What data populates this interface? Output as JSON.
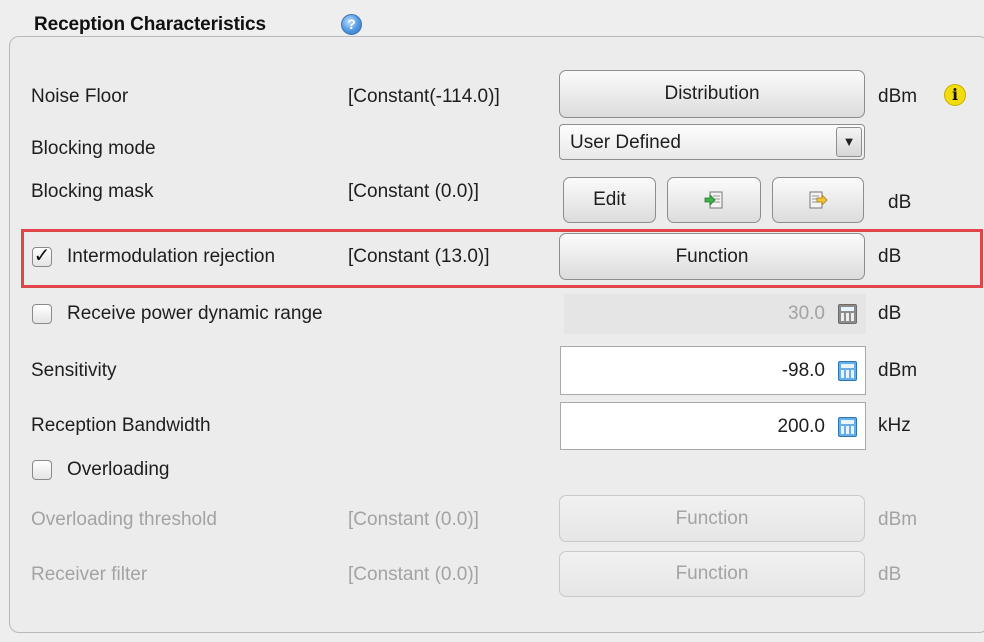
{
  "section": {
    "title": "Reception Characteristics"
  },
  "rows": {
    "noise_floor": {
      "label": "Noise Floor",
      "value": "[Constant(-114.0)]",
      "button": "Distribution",
      "unit": "dBm"
    },
    "blocking_mode": {
      "label": "Blocking mode",
      "selected": "User Defined"
    },
    "blocking_mask": {
      "label": "Blocking mask",
      "value": "[Constant (0.0)]",
      "edit_button": "Edit",
      "unit": "dB"
    },
    "intermodulation": {
      "label": "Intermodulation rejection",
      "checked": true,
      "value": "[Constant (13.0)]",
      "button": "Function",
      "unit": "dB"
    },
    "receive_power_dynamic_range": {
      "label": "Receive power dynamic range",
      "checked": false,
      "value": "30.0",
      "unit": "dB"
    },
    "sensitivity": {
      "label": "Sensitivity",
      "value": "-98.0",
      "unit": "dBm"
    },
    "reception_bandwidth": {
      "label": "Reception Bandwidth",
      "value": "200.0",
      "unit": "kHz"
    },
    "overloading": {
      "label": "Overloading",
      "checked": false
    },
    "overloading_threshold": {
      "label": "Overloading threshold",
      "value": "[Constant (0.0)]",
      "button": "Function",
      "unit": "dBm"
    },
    "receiver_filter": {
      "label": "Receiver filter",
      "value": "[Constant (0.0)]",
      "button": "Function",
      "unit": "dB"
    }
  },
  "icons": {
    "help": "help-question-icon",
    "info": "info-icon",
    "import": "import-icon",
    "export": "export-icon",
    "calculator": "calculator-icon",
    "dropdown": "chevron-down-icon"
  },
  "colors": {
    "highlight": "#e0454a",
    "info": "#f2dc0b",
    "help": "#4f97e0"
  }
}
